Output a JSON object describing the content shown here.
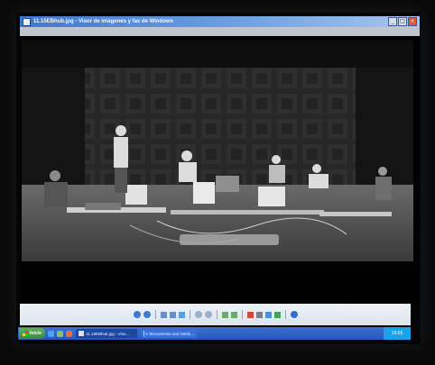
{
  "window": {
    "title": "11.15EBhub.jpg - Visor de imágenes y fax de Windows",
    "buttons": [
      "_",
      "□",
      "×"
    ]
  },
  "taskbar": {
    "start_label": "Inicio",
    "tasks": [
      {
        "label": "11.15EBhub.jpg - Viso..."
      },
      {
        "label": "C:\\Documents and Settin..."
      }
    ],
    "clock": "19:05"
  },
  "toolbar": {
    "icons": [
      "previous-image-icon",
      "next-image-icon",
      "best-fit-icon",
      "actual-size-icon",
      "slideshow-icon",
      "zoom-in-icon",
      "zoom-out-icon",
      "rotate-clockwise-icon",
      "rotate-counterclockwise-icon",
      "delete-icon",
      "print-icon",
      "copy-to-icon",
      "edit-icon",
      "help-icon"
    ]
  },
  "colors": {
    "titlebar": "#3d78cf",
    "taskbar": "#2756b8",
    "start": "#3a8a35"
  }
}
